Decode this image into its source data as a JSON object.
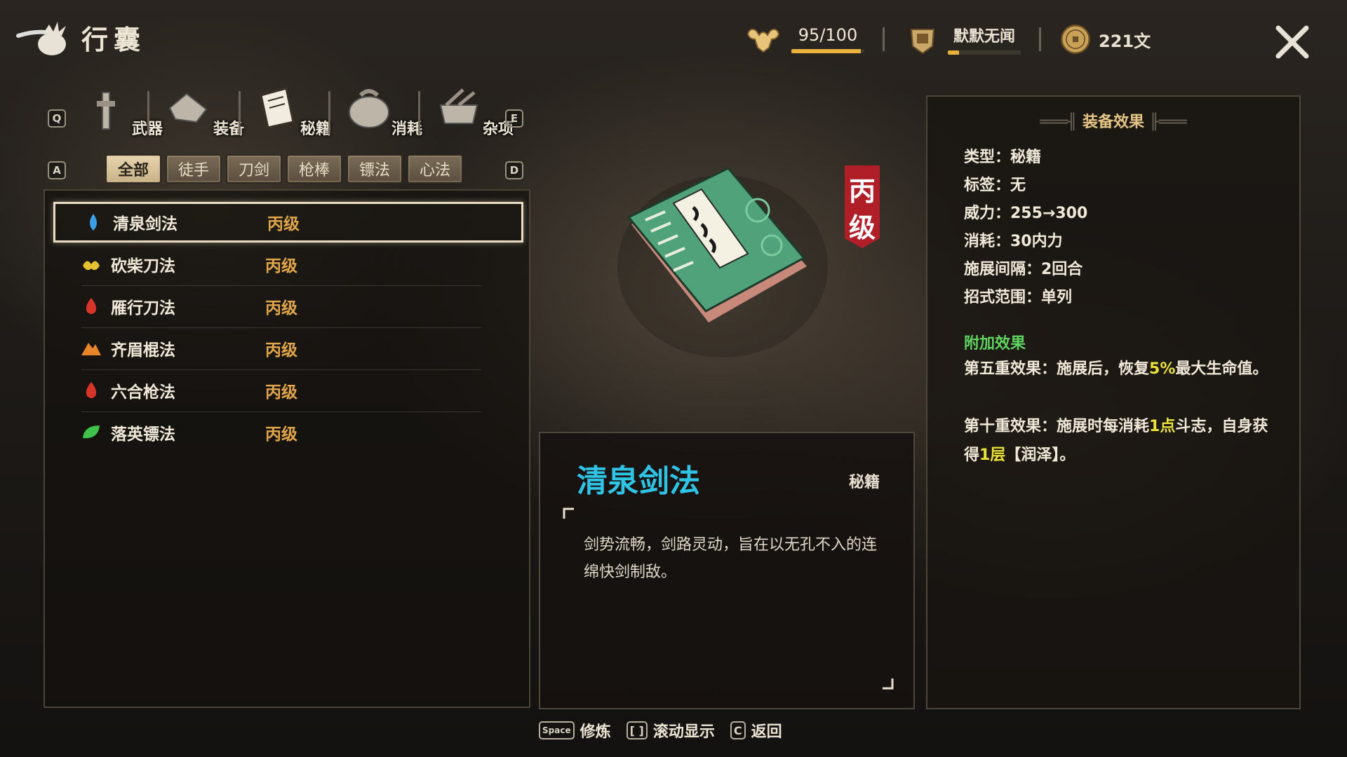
{
  "header": {
    "title": "行囊",
    "title_icon": "bundle-icon",
    "hp": {
      "text": "95/100",
      "fill": 0.95,
      "icon": "muscle-icon",
      "bar_color": "#e8b23c"
    },
    "reputation": {
      "text": "默默无闻",
      "fill": 0.15,
      "icon": "reputation-icon",
      "bar_color": "#e8b23c"
    },
    "money": {
      "text": "221文",
      "icon": "coin-icon"
    },
    "close_icon": "close-icon"
  },
  "category_tabs": {
    "prev_key": "Q",
    "next_key": "E",
    "items": [
      {
        "label": "武器",
        "icon": "weapon-icon"
      },
      {
        "label": "装备",
        "icon": "armor-icon"
      },
      {
        "label": "秘籍",
        "icon": "manual-icon",
        "active": true
      },
      {
        "label": "消耗",
        "icon": "consumable-icon"
      },
      {
        "label": "杂项",
        "icon": "misc-icon"
      }
    ]
  },
  "filters": {
    "prev_key": "A",
    "next_key": "D",
    "items": [
      "全部",
      "徒手",
      "刀剑",
      "枪棒",
      "镖法",
      "心法"
    ],
    "active_index": 0
  },
  "list": {
    "items": [
      {
        "name": "清泉剑法",
        "grade": "丙级",
        "icon": "water-icon",
        "icon_color": "#3aa0e8",
        "selected": true
      },
      {
        "name": "砍柴刀法",
        "grade": "丙级",
        "icon": "wind-icon",
        "icon_color": "#e6c22e"
      },
      {
        "name": "雁行刀法",
        "grade": "丙级",
        "icon": "fire-icon",
        "icon_color": "#d8352a"
      },
      {
        "name": "齐眉棍法",
        "grade": "丙级",
        "icon": "mountain-icon",
        "icon_color": "#e8842a"
      },
      {
        "name": "六合枪法",
        "grade": "丙级",
        "icon": "fire-icon",
        "icon_color": "#d8352a"
      },
      {
        "name": "落英镖法",
        "grade": "丙级",
        "icon": "leaf-icon",
        "icon_color": "#3ec24a"
      }
    ]
  },
  "preview": {
    "grade_badge": [
      "丙",
      "级"
    ],
    "book_icon": "green-manual-book-icon"
  },
  "description": {
    "title": "清泉剑法",
    "type": "秘籍",
    "text": "剑势流畅，剑路灵动，旨在以无孔不入的连绵快剑制敌。"
  },
  "effects": {
    "header": "装备效果",
    "lines": [
      "类型：秘籍",
      "标签：无",
      "威力：255→300",
      "消耗：30内力",
      "施展间隔：2回合",
      "招式范围：单列"
    ],
    "extra_title": "附加效果",
    "extra_1": {
      "a": "第五重效果：施展后，恢复",
      "h1": "5%",
      "b": "最大生命值。"
    },
    "extra_2": {
      "a": "第十重效果：施展时每消耗",
      "h1": "1点",
      "b": "斗志，自身获得",
      "h2": "1层",
      "c": "【润泽】。"
    }
  },
  "footer": {
    "items": [
      {
        "key": "Space",
        "label": "修炼"
      },
      {
        "key": "[ ]",
        "label": "滚动显示"
      },
      {
        "key": "C",
        "label": "返回"
      }
    ]
  }
}
